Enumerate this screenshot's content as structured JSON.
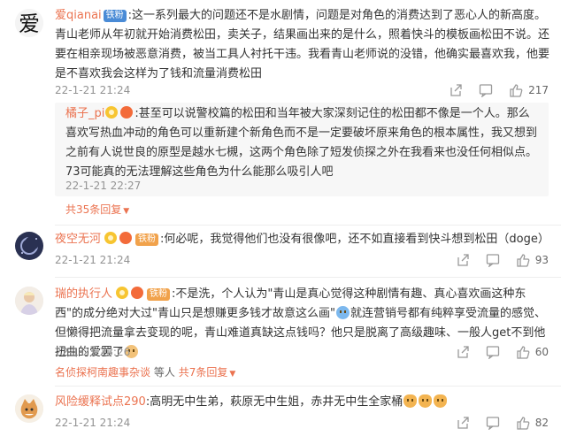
{
  "comments": [
    {
      "user": "爱qianai",
      "badge": "铁粉",
      "text": ":这一系列最大的问题还不是水剧情，问题是对角色的消费达到了恶心人的新高度。青山老师从年初就开始消费松田，卖关子，结果画出来的是什么，照着快斗的模板画松田不说。还要在相亲现场被恶意消费，被当工具人衬托干违。我看青山老师说的没错，他确实最喜欢我，他要是不喜欢我会这样为了钱和流量消费松田",
      "avatar_char": "爱",
      "time": "22-1-21 21:24",
      "likes": "217",
      "reply": {
        "user": "橘子_pi",
        "text": ":甚至可以说警校篇的松田和当年被大家深刻记住的松田都不像是一个人。那么喜欢写热血冲动的角色可以重新建个新角色而不是一定要破坏原来角色的根本属性，我又想到之前有人说世良的原型是越水七槻，这两个角色除了短发侦探之外在我看来也没任何相似点。73可能真的无法理解这些角色为什么能那么吸引人吧",
        "time": "22-1-21 22:27"
      },
      "more": "共35条回复"
    },
    {
      "user": "夜空无河",
      "badge": "铁粉",
      "text": ":何必呢，我觉得他们也没有很像吧，还不如直接看到快斗想到松田（doge）",
      "time": "22-1-21 21:24",
      "likes": "93"
    },
    {
      "user": "瑞的执行人",
      "badge": "铁粉",
      "text_a": ":不是洗，个人认为\"青山是真心觉得这种剧情有趣、真心喜欢画这种东西\"的成分绝对大过\"青山只是想赚更多钱才故意这么画\"",
      "text_b": "就连营销号都有纯粹享受流量的感觉、但懒得把流量拿去变现的呢，青山难道真缺这点钱吗？他只是脱离了高级趣味、一般人get不到他扭曲的爱罢了",
      "time": "22-1-21 23:26",
      "likes": "60",
      "reply_preview_user": "名侦探柯南趣事杂谈",
      "reply_preview_mid": "等人",
      "more": "共7条回复"
    },
    {
      "user": "风险缓释试点290",
      "text": ":高明无中生弟，萩原无中生姐，赤井无中生全家桶",
      "time": "22-1-21 21:24",
      "likes": "82"
    }
  ],
  "colors": {
    "accent": "#eb7350",
    "meta": "#939393",
    "reply_bg": "#f7f7f7"
  },
  "icons": [
    "share-icon",
    "comment-icon",
    "like-icon",
    "chevron-down-icon",
    "crown-icon",
    "vip-icon"
  ]
}
